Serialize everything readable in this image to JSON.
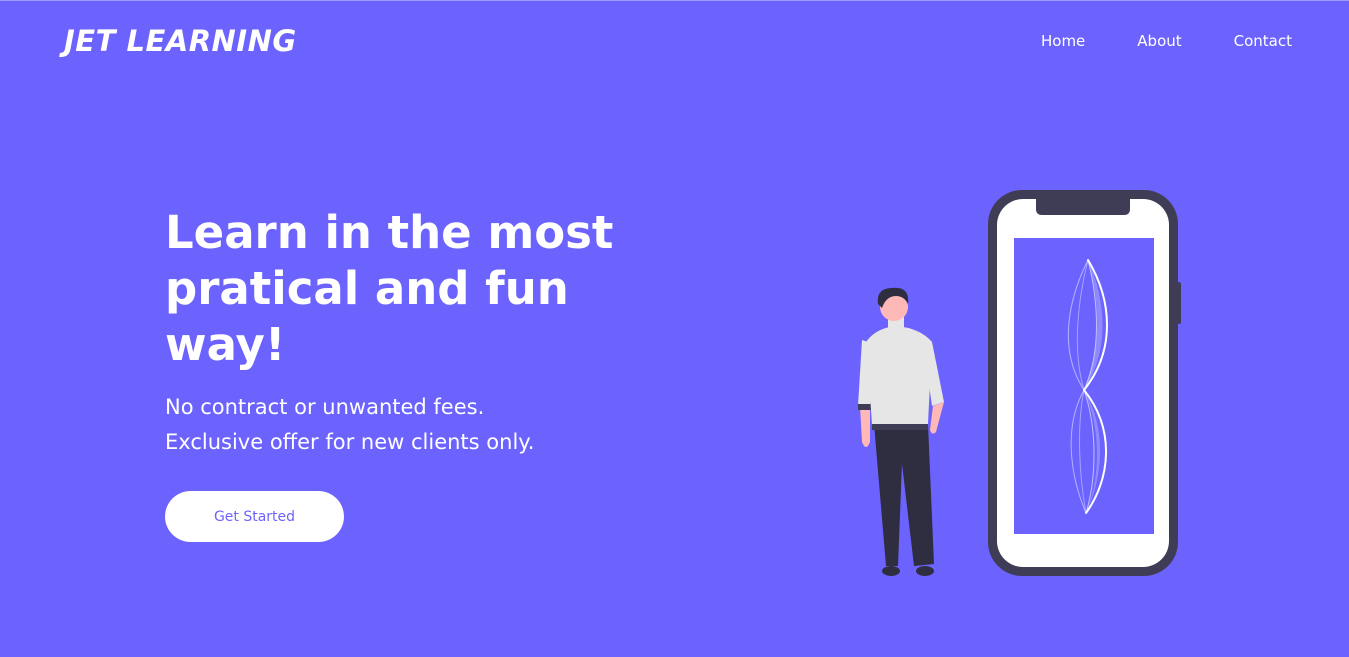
{
  "header": {
    "logo": "JET LEARNING",
    "nav": [
      "Home",
      "About",
      "Contact"
    ]
  },
  "hero": {
    "title": "Learn in the most pratical and fun way!",
    "subtitle_lines": [
      "No contract or unwanted fees.",
      "Exclusive offer for new clients only."
    ],
    "cta_label": "Get Started"
  },
  "illustration": {
    "subject": "person-standing-next-to-phone",
    "icons": [
      "person",
      "smartphone",
      "waveform"
    ]
  },
  "colors": {
    "background": "#6c63ff",
    "text": "#ffffff",
    "button_bg": "#ffffff",
    "button_text": "#6c63ff",
    "phone_frame": "#3f3d56",
    "shirt": "#e6e6e6",
    "pants": "#2f2e41",
    "skin": "#ffb8b8"
  }
}
